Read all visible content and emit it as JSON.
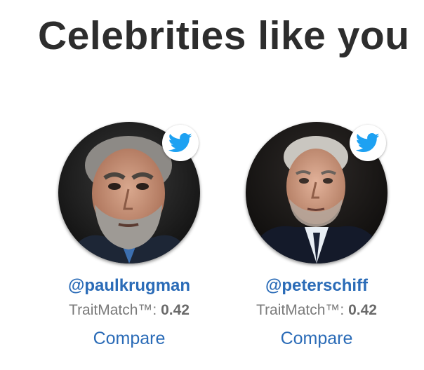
{
  "header": {
    "title": "Celebrities like you"
  },
  "celebrities": [
    {
      "handle": "@paulkrugman",
      "match_label": "TraitMatch™: ",
      "match_score": "0.42",
      "compare_label": "Compare",
      "icon": "twitter-icon"
    },
    {
      "handle": "@peterschiff",
      "match_label": "TraitMatch™: ",
      "match_score": "0.42",
      "compare_label": "Compare",
      "icon": "twitter-icon"
    }
  ],
  "colors": {
    "title": "#2d2d2d",
    "link": "#2a6bb7",
    "muted": "#7a7a7a",
    "twitter": "#1da1f2"
  }
}
